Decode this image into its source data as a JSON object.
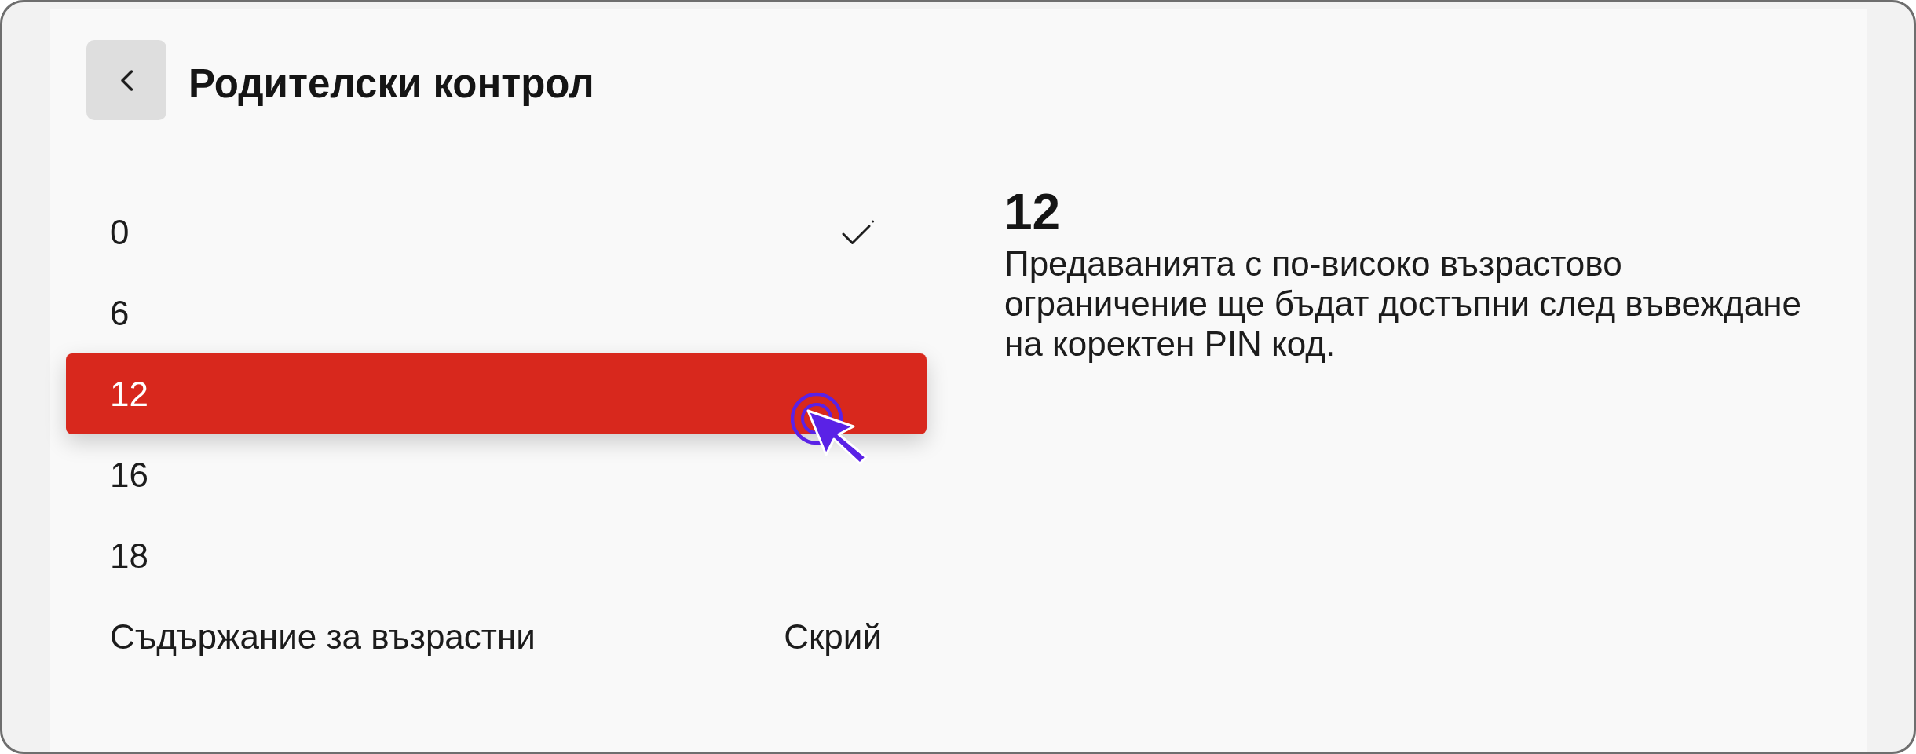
{
  "header": {
    "title": "Родителски контрол"
  },
  "options": [
    {
      "kind": "option",
      "label": "0",
      "checked": true,
      "selected": false
    },
    {
      "kind": "option",
      "label": "6",
      "checked": false,
      "selected": false
    },
    {
      "kind": "option",
      "label": "12",
      "checked": false,
      "selected": true
    },
    {
      "kind": "option",
      "label": "16",
      "checked": false,
      "selected": false
    },
    {
      "kind": "option",
      "label": "18",
      "checked": false,
      "selected": false
    },
    {
      "kind": "setting",
      "label": "Съдържание за възрастни",
      "value": "Скрий",
      "checked": false,
      "selected": false
    }
  ],
  "details": {
    "title": "12",
    "description": "Предаванията с по-високо възрастово ограничение ще бъдат достъпни след въвеждане на коректен PIN код."
  }
}
